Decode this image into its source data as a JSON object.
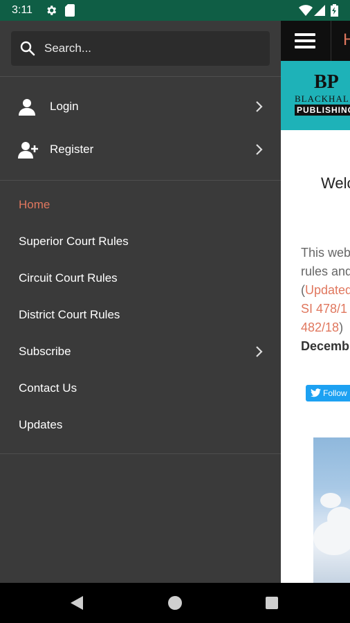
{
  "status_bar": {
    "time": "3:11",
    "icons": [
      "settings-gear-icon",
      "sd-card-icon",
      "wifi-icon",
      "signal-icon",
      "battery-charging-icon"
    ],
    "background": "#0f5e45"
  },
  "drawer": {
    "search": {
      "placeholder": "Search..."
    },
    "account_items": [
      {
        "label": "Login",
        "icon": "user-icon",
        "has_chevron": true
      },
      {
        "label": "Register",
        "icon": "user-add-icon",
        "has_chevron": true
      }
    ],
    "nav_items": [
      {
        "label": "Home",
        "active": true,
        "has_chevron": false
      },
      {
        "label": "Superior Court Rules",
        "active": false,
        "has_chevron": false
      },
      {
        "label": "Circuit Court Rules",
        "active": false,
        "has_chevron": false
      },
      {
        "label": "District Court Rules",
        "active": false,
        "has_chevron": false
      },
      {
        "label": "Subscribe",
        "active": false,
        "has_chevron": true
      },
      {
        "label": "Contact Us",
        "active": false,
        "has_chevron": false
      },
      {
        "label": "Updates",
        "active": false,
        "has_chevron": false
      }
    ],
    "background": "#3a3a3a",
    "active_color": "#e0775e"
  },
  "content": {
    "topbar_letter": "H",
    "logo": {
      "mark": "BP",
      "line1": "BLACKHAL",
      "line2": "PUBLISHING"
    },
    "welcome": "Welc",
    "paragraph_lines": [
      {
        "text": "This web",
        "style": "gray"
      },
      {
        "text": "rules and",
        "style": "gray"
      },
      {
        "prefix": "(",
        "text": "Updated",
        "style": "orange"
      },
      {
        "text": "SI 478/1",
        "style": "orange"
      },
      {
        "text": "482/18",
        "suffix": ")",
        "style": "orange"
      },
      {
        "text": "Decemb",
        "style": "bold"
      }
    ],
    "follow_button": "Follow",
    "banner_color": "#1eb2b8"
  },
  "navbar": {
    "buttons": [
      "back-icon",
      "home-icon",
      "recents-icon"
    ]
  }
}
